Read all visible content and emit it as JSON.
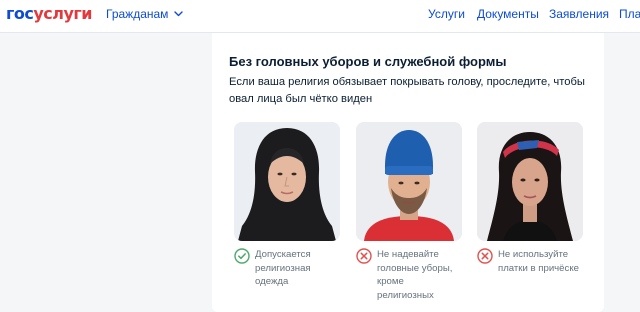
{
  "header": {
    "logo_part1": "гос",
    "logo_part2": "услуги",
    "citizens_label": "Гражданам",
    "nav": [
      "Услуги",
      "Документы",
      "Заявления",
      "Плат"
    ]
  },
  "section": {
    "title": "Без головных уборов и служебной формы",
    "description": "Если ваша религия обязывает покрывать голову, проследите, чтобы овал лица был чётко виден",
    "examples": [
      {
        "status": "allowed",
        "caption": "Допускается религиозная одежда",
        "icon": "check-circle-icon"
      },
      {
        "status": "forbidden",
        "caption": "Не надевайте головные уборы, кроме религиозных",
        "icon": "cross-circle-icon"
      },
      {
        "status": "forbidden",
        "caption": "Не используйте платки в причёске",
        "icon": "cross-circle-icon"
      }
    ]
  },
  "colors": {
    "brand_blue": "#0d4cd3",
    "brand_red": "#e4393c",
    "allowed": "#4ea96b",
    "forbidden": "#e0524e"
  }
}
